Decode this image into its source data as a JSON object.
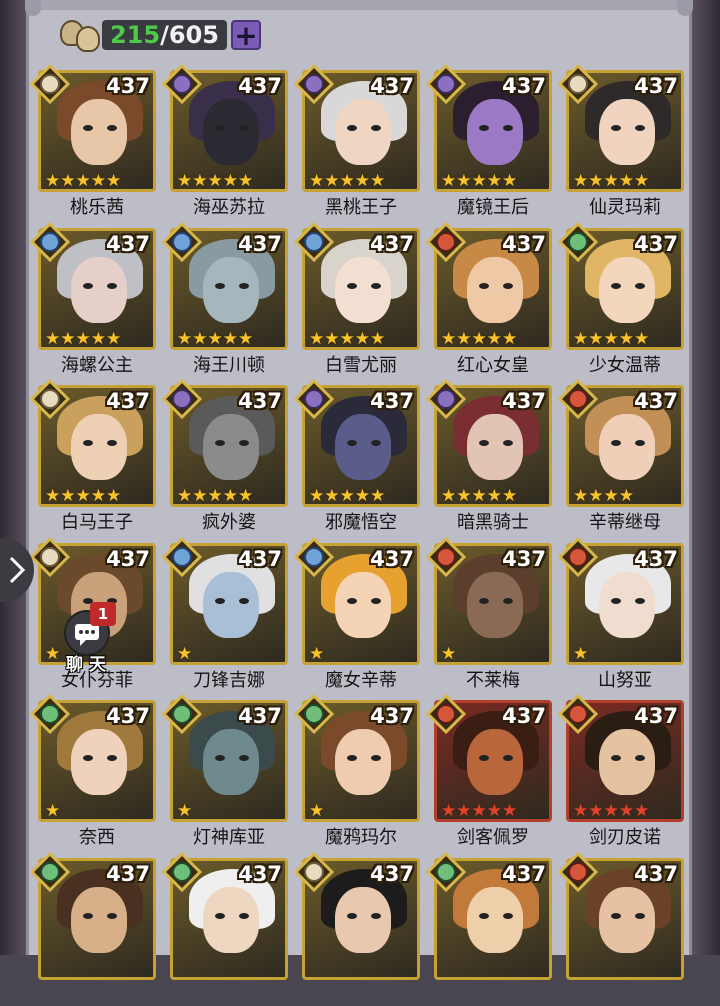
{
  "counter": {
    "current": "215",
    "sep": "/",
    "max": "605",
    "plus_icon": "plus-icon"
  },
  "side_nav": {
    "icon": "chevron-right-icon"
  },
  "chat": {
    "count": "1",
    "label": "聊天",
    "icon": "chat-bubble-icon"
  },
  "colors": {
    "frame_gold": "#c5a233",
    "frame_red": "#b23f2c",
    "counter_green": "#4ec94a",
    "star_gold": "#f6c32c",
    "star_red": "#e0422e"
  },
  "heroes": [
    {
      "name": "桃乐茜",
      "level": "437",
      "stars": 5,
      "star_color": "gold",
      "badge": "star-badge-icon",
      "frame": "gold",
      "tone": "#e8c7a8",
      "hair": "#7b4a2a"
    },
    {
      "name": "海巫苏拉",
      "level": "437",
      "stars": 5,
      "star_color": "gold",
      "badge": "eye-badge-icon",
      "frame": "gold",
      "tone": "#2b2a33",
      "hair": "#3a2f4a"
    },
    {
      "name": "黑桃王子",
      "level": "437",
      "stars": 5,
      "star_color": "gold",
      "badge": "eye-badge-icon",
      "frame": "gold",
      "tone": "#eed6c3",
      "hair": "#d8d8d8"
    },
    {
      "name": "魔镜王后",
      "level": "437",
      "stars": 5,
      "star_color": "gold",
      "badge": "eye-badge-icon",
      "frame": "gold",
      "tone": "#9b79c4",
      "hair": "#2b1e2e"
    },
    {
      "name": "仙灵玛莉",
      "level": "437",
      "stars": 5,
      "star_color": "gold",
      "badge": "star-badge-icon",
      "frame": "gold",
      "tone": "#f0d4bf",
      "hair": "#2e2a2a"
    },
    {
      "name": "海螺公主",
      "level": "437",
      "stars": 5,
      "star_color": "gold",
      "badge": "water-badge-icon",
      "frame": "gold",
      "tone": "#e5cfc8",
      "hair": "#bfbfc6"
    },
    {
      "name": "海王川顿",
      "level": "437",
      "stars": 5,
      "star_color": "gold",
      "badge": "water-badge-icon",
      "frame": "gold",
      "tone": "#a6b6bd",
      "hair": "#8a9aa3"
    },
    {
      "name": "白雪尤丽",
      "level": "437",
      "stars": 5,
      "star_color": "gold",
      "badge": "water-badge-icon",
      "frame": "gold",
      "tone": "#f2dfd2",
      "hair": "#d8d4cc"
    },
    {
      "name": "红心女皇",
      "level": "437",
      "stars": 5,
      "star_color": "gold",
      "badge": "fire-badge-icon",
      "frame": "gold",
      "tone": "#efc9a6",
      "hair": "#c68a46"
    },
    {
      "name": "少女温蒂",
      "level": "437",
      "stars": 5,
      "star_color": "gold",
      "badge": "wind-badge-icon",
      "frame": "gold",
      "tone": "#f3d7bc",
      "hair": "#e0b565"
    },
    {
      "name": "白马王子",
      "level": "437",
      "stars": 5,
      "star_color": "gold",
      "badge": "star-badge-icon",
      "frame": "gold",
      "tone": "#eed0b5",
      "hair": "#c9a15d"
    },
    {
      "name": "疯外婆",
      "level": "437",
      "stars": 5,
      "star_color": "gold",
      "badge": "eye-badge-icon",
      "frame": "gold",
      "tone": "#8b8b8b",
      "hair": "#5a5a5a"
    },
    {
      "name": "邪魔悟空",
      "level": "437",
      "stars": 5,
      "star_color": "gold",
      "badge": "eye-badge-icon",
      "frame": "gold",
      "tone": "#5a5d8a",
      "hair": "#2a2a3a"
    },
    {
      "name": "暗黑骑士",
      "level": "437",
      "stars": 5,
      "star_color": "gold",
      "badge": "eye-badge-icon",
      "frame": "gold",
      "tone": "#e2c4b4",
      "hair": "#7a2e32"
    },
    {
      "name": "辛蒂继母",
      "level": "437",
      "stars": 4,
      "star_color": "gold",
      "badge": "fire-badge-icon",
      "frame": "gold",
      "tone": "#efcfb8",
      "hair": "#c28f57"
    },
    {
      "name": "女仆芬菲",
      "level": "437",
      "stars": 1,
      "star_color": "gold",
      "badge": "star-badge-icon",
      "frame": "gold",
      "tone": "#c9a27c",
      "hair": "#6b4a2c"
    },
    {
      "name": "刀锋吉娜",
      "level": "437",
      "stars": 1,
      "star_color": "gold",
      "badge": "water-badge-icon",
      "frame": "gold",
      "tone": "#a8bfd6",
      "hair": "#e0e0e0"
    },
    {
      "name": "魔女辛蒂",
      "level": "437",
      "stars": 1,
      "star_color": "gold",
      "badge": "water-badge-icon",
      "frame": "gold",
      "tone": "#f4d4b5",
      "hair": "#e6a12f"
    },
    {
      "name": "不莱梅",
      "level": "437",
      "stars": 1,
      "star_color": "gold",
      "badge": "fire-badge-icon",
      "frame": "gold",
      "tone": "#8a6a55",
      "hair": "#5c3e2c"
    },
    {
      "name": "山努亚",
      "level": "437",
      "stars": 1,
      "star_color": "gold",
      "badge": "fire-badge-icon",
      "frame": "gold",
      "tone": "#f0ddd0",
      "hair": "#e8e8e8"
    },
    {
      "name": "奈西",
      "level": "437",
      "stars": 1,
      "star_color": "gold",
      "badge": "wind-badge-icon",
      "frame": "gold",
      "tone": "#efd2bb",
      "hair": "#a07a3c"
    },
    {
      "name": "灯神库亚",
      "level": "437",
      "stars": 1,
      "star_color": "gold",
      "badge": "wind-badge-icon",
      "frame": "gold",
      "tone": "#6e8a8e",
      "hair": "#3b4a4a"
    },
    {
      "name": "魔鸦玛尔",
      "level": "437",
      "stars": 1,
      "star_color": "gold",
      "badge": "wind-badge-icon",
      "frame": "gold",
      "tone": "#efccaf",
      "hair": "#7b4a2a"
    },
    {
      "name": "剑客佩罗",
      "level": "437",
      "stars": 5,
      "star_color": "red",
      "badge": "fire-badge-icon",
      "frame": "red",
      "tone": "#b8663a",
      "hair": "#3a1e14"
    },
    {
      "name": "剑刃皮诺",
      "level": "437",
      "stars": 5,
      "star_color": "red",
      "badge": "fire-badge-icon",
      "frame": "red",
      "tone": "#e5c3a0",
      "hair": "#2a1e14"
    },
    {
      "name": "",
      "level": "437",
      "stars": 0,
      "star_color": "gold",
      "badge": "wind-badge-icon",
      "frame": "gold",
      "tone": "#d7b08a",
      "hair": "#4a3020"
    },
    {
      "name": "",
      "level": "437",
      "stars": 0,
      "star_color": "gold",
      "badge": "wind-badge-icon",
      "frame": "gold",
      "tone": "#eed7c0",
      "hair": "#efefef"
    },
    {
      "name": "",
      "level": "437",
      "stars": 0,
      "star_color": "gold",
      "badge": "star-badge-icon",
      "frame": "gold",
      "tone": "#e8c9b0",
      "hair": "#1c1c1c"
    },
    {
      "name": "",
      "level": "437",
      "stars": 0,
      "star_color": "gold",
      "badge": "wind-badge-icon",
      "frame": "gold",
      "tone": "#efcfaa",
      "hair": "#c27a3a"
    },
    {
      "name": "",
      "level": "437",
      "stars": 0,
      "star_color": "gold",
      "badge": "fire-badge-icon",
      "frame": "gold",
      "tone": "#e6c2a2",
      "hair": "#6a4228"
    }
  ]
}
